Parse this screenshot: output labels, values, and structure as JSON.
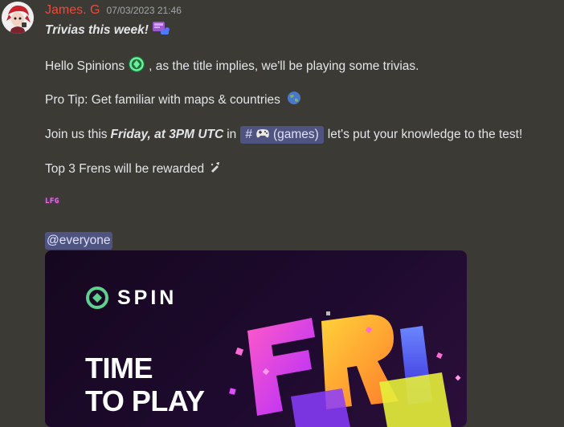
{
  "message": {
    "author": "James. G",
    "timestamp": "07/03/2023 21:46",
    "title": "Trivias this week!",
    "line2_before": "Hello Spinions",
    "line2_after": ", as the title implies, we'll be playing some trivias.",
    "line3": "Pro Tip: Get familiar with maps & countries",
    "line4_before": "Join us this",
    "line4_bold": "Friday, at 3PM UTC",
    "line4_in": "in",
    "channel_hash": "#",
    "channel_name": "(games)",
    "line4_after": "let's put your knowledge to the test!",
    "line5": "Top 3 Frens will be rewarded",
    "lfg": "LFG",
    "everyone": "@everyone"
  },
  "embed": {
    "brand": "SPIN",
    "hero_line1": "TIME",
    "hero_line2": "TO PLAY"
  },
  "colors": {
    "background": "#3b3a35",
    "author": "#e74c3c",
    "mention_bg": "#4f5380"
  },
  "icons": [
    "avatar",
    "trivia-emoji",
    "spin-emoji",
    "globe-emoji",
    "controller-emoji",
    "reward-emoji",
    "spin-logo-icon"
  ]
}
